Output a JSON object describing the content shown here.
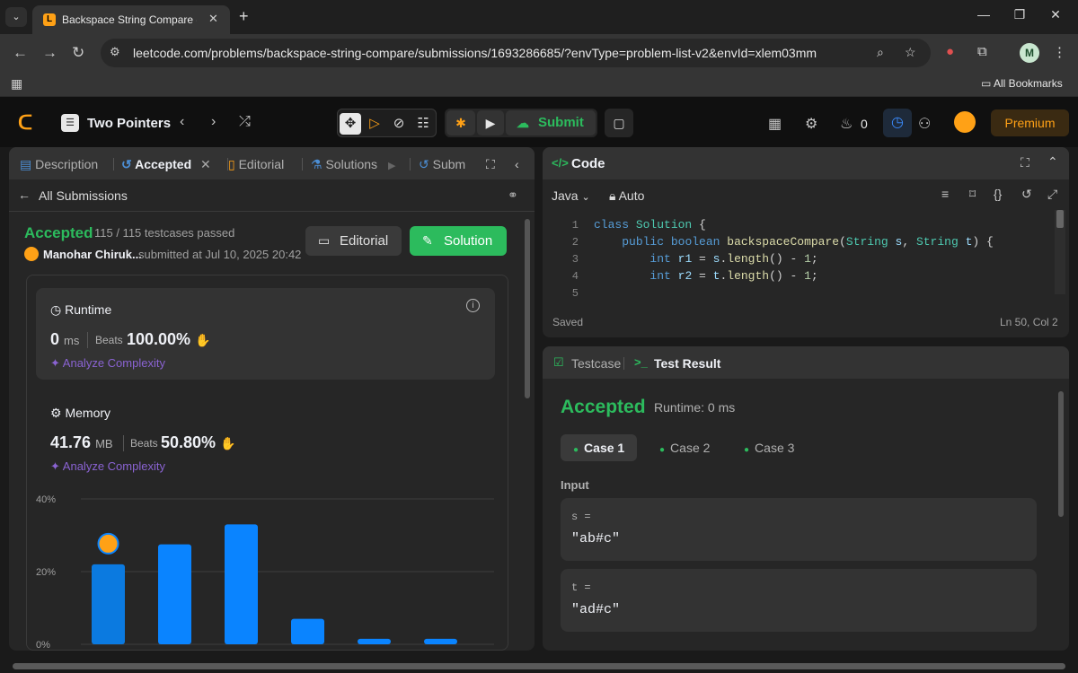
{
  "browser": {
    "tab_title": "Backspace String Compare - Le",
    "url": "leetcode.com/problems/backspace-string-compare/submissions/1693286685/?envType=problem-list-v2&envId=xlem03mm",
    "profile_initial": "M",
    "bookmarks_label": "All Bookmarks"
  },
  "nav": {
    "problem_list_title": "Two Pointers",
    "submit_label": "Submit",
    "streak_count": "0",
    "premium_label": "Premium"
  },
  "left_tabs": {
    "description": "Description",
    "accepted": "Accepted",
    "editorial": "Editorial",
    "solutions": "Solutions",
    "submissions": "Subm"
  },
  "submission": {
    "all_submissions_label": "All Submissions",
    "status": "Accepted",
    "testcases": "115 / 115 testcases passed",
    "submitter": "Manohar Chiruk...",
    "submitted_at": "submitted at Jul 10, 2025 20:42",
    "editorial_btn": "Editorial",
    "solution_btn": "Solution"
  },
  "runtime": {
    "title": "Runtime",
    "value": "0",
    "unit": "ms",
    "beats_label": "Beats",
    "beats_value": "100.00%",
    "analyze": "Analyze Complexity"
  },
  "memory": {
    "title": "Memory",
    "value": "41.76",
    "unit": "MB",
    "beats_label": "Beats",
    "beats_value": "50.80%",
    "analyze": "Analyze Complexity"
  },
  "chart_data": {
    "type": "bar",
    "ylabels": [
      "40%",
      "20%",
      "0%"
    ],
    "ylim": [
      0,
      40
    ],
    "values": [
      22,
      27.5,
      33,
      7,
      1.5,
      1.5
    ],
    "highlight_index": 0,
    "color": "#0a84ff"
  },
  "code": {
    "title": "Code",
    "language": "Java",
    "auto": "Auto",
    "line_numbers": [
      "1",
      "2",
      "3",
      "4",
      "5"
    ],
    "saved": "Saved",
    "cursor": "Ln 50, Col 2"
  },
  "result": {
    "testcase_tab": "Testcase",
    "result_tab": "Test Result",
    "status": "Accepted",
    "runtime": "Runtime: 0 ms",
    "cases": [
      "Case 1",
      "Case 2",
      "Case 3"
    ],
    "input_label": "Input",
    "vars": [
      {
        "name": "s =",
        "value": "\"ab#c\""
      },
      {
        "name": "t =",
        "value": "\"ad#c\""
      }
    ]
  },
  "colors": {
    "accepted_green": "#2cbb5d",
    "brand_orange": "#ffa116",
    "bar_blue": "#0a84ff"
  }
}
